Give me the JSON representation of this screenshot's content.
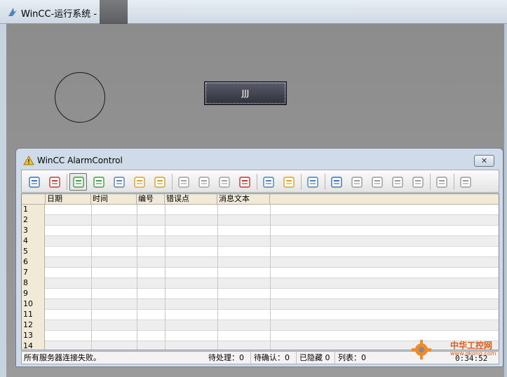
{
  "window": {
    "title": "WinCC-运行系统 -"
  },
  "runtime": {
    "button_label": "JJJ"
  },
  "alarm_control": {
    "title": "WinCC AlarmControl",
    "close_label": "✕",
    "toolbar": [
      {
        "icon": "help-icon",
        "color": "#3a6fc4"
      },
      {
        "icon": "configure-dialog-icon",
        "color": "#c43a3a"
      },
      "sep",
      {
        "icon": "message-list-icon",
        "color": "#3aa040",
        "active": true
      },
      {
        "icon": "short-term-archive-icon",
        "color": "#3aa040"
      },
      {
        "icon": "long-term-archive-icon",
        "color": "#5a7db0"
      },
      {
        "icon": "lock-list-icon",
        "color": "#e0a020"
      },
      {
        "icon": "hit-list-icon",
        "color": "#d4a020"
      },
      "sep",
      {
        "icon": "single-acknowledge-icon",
        "color": "#a0a0a0"
      },
      {
        "icon": "group-acknowledge-icon",
        "color": "#a0a0a0"
      },
      {
        "icon": "auto-scroll-icon",
        "color": "#a0a0a0"
      },
      {
        "icon": "emergency-acknowledge-icon",
        "color": "#d03030"
      },
      "sep",
      {
        "icon": "selection-dialog-icon",
        "color": "#4a7fc0"
      },
      {
        "icon": "display-options-icon",
        "color": "#e0a020"
      },
      "sep",
      {
        "icon": "print-icon",
        "color": "#4a7fc0"
      },
      "sep",
      {
        "icon": "sort-dialog-icon",
        "color": "#3a6fc4"
      },
      {
        "icon": "first-message-icon",
        "color": "#9a9a9a"
      },
      {
        "icon": "previous-message-icon",
        "color": "#9a9a9a"
      },
      {
        "icon": "next-message-icon",
        "color": "#9a9a9a"
      },
      {
        "icon": "last-message-icon",
        "color": "#9a9a9a"
      },
      "sep",
      {
        "icon": "info-text-icon",
        "color": "#9a9a9a"
      },
      "sep",
      {
        "icon": "comment-icon",
        "color": "#9a9a9a"
      }
    ],
    "columns": [
      "日期",
      "时间",
      "编号",
      "错误点",
      "消息文本"
    ],
    "rows": [
      "1",
      "2",
      "3",
      "4",
      "5",
      "6",
      "7",
      "8",
      "9",
      "10",
      "11",
      "12",
      "13",
      "14"
    ],
    "status": {
      "message": "所有服务器连接失败。",
      "pending": "待处理：0",
      "unacknowledged": "待确认：0",
      "hidden": "已隐藏 0",
      "list": "列表：0",
      "time": "0:34:52"
    }
  },
  "watermark": {
    "text": "中华工控网",
    "sub": "www.gkong.com"
  }
}
